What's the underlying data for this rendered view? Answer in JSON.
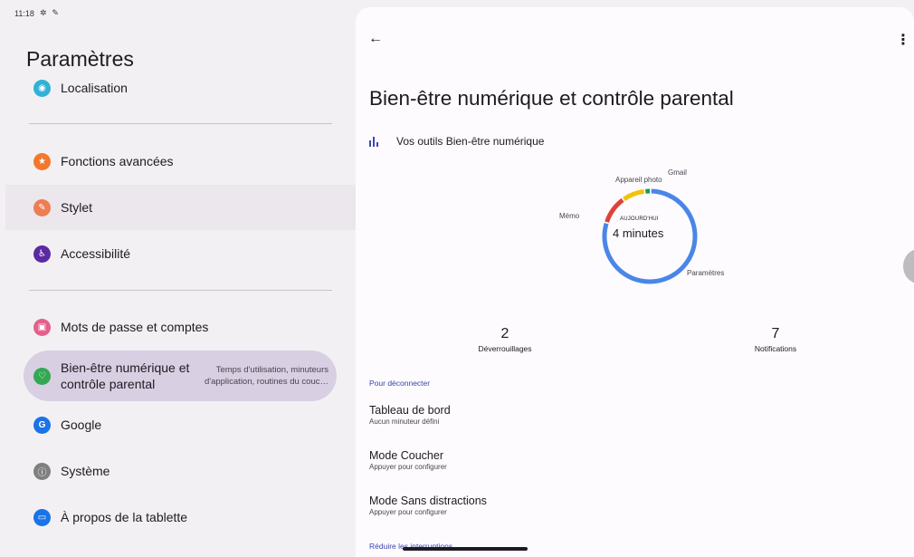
{
  "status_bar": {
    "time": "11:18"
  },
  "left": {
    "title": "Paramètres",
    "items": [
      {
        "label": "Localisation",
        "color": "#2fb2d6"
      },
      {
        "label": "Fonctions avancées",
        "color": "#f2782c"
      },
      {
        "label": "Stylet",
        "color": "#ef7c52"
      },
      {
        "label": "Accessibilité",
        "color": "#5b2aa3"
      },
      {
        "label": "Mots de passe et comptes",
        "color": "#e45f8c"
      },
      {
        "label": "Bien-être numérique et contrôle parental",
        "sub": "Temps d'utilisation, minuteurs d'application, routines du couc…",
        "color": "#33a852"
      },
      {
        "label": "Google",
        "color": "#1a73e8"
      },
      {
        "label": "Système",
        "color": "#808080"
      },
      {
        "label": "À propos de la tablette",
        "color": "#1a73e8"
      }
    ]
  },
  "right": {
    "title": "Bien-être numérique et contrôle parental",
    "tools_label": "Vos outils Bien-être numérique",
    "chart_data": {
      "type": "pie",
      "center_label": "AUJOURD'HUI",
      "center_value": "4 minutes",
      "categories": [
        "Paramètres",
        "Mémo",
        "Appareil photo",
        "Gmail"
      ],
      "values": [
        78,
        10,
        8,
        2
      ],
      "colors": [
        "#4a86e8",
        "#db4437",
        "#f4c20d",
        "#0f9d58"
      ]
    },
    "stats": [
      {
        "value": "2",
        "label": "Déverrouillages"
      },
      {
        "value": "7",
        "label": "Notifications"
      }
    ],
    "section1": "Pour déconnecter",
    "rows": [
      {
        "title": "Tableau de bord",
        "sub": "Aucun minuteur défini"
      },
      {
        "title": "Mode Coucher",
        "sub": "Appuyer pour configurer"
      },
      {
        "title": "Mode Sans distractions",
        "sub": "Appuyer pour configurer"
      }
    ],
    "section2": "Réduire les interruptions"
  }
}
